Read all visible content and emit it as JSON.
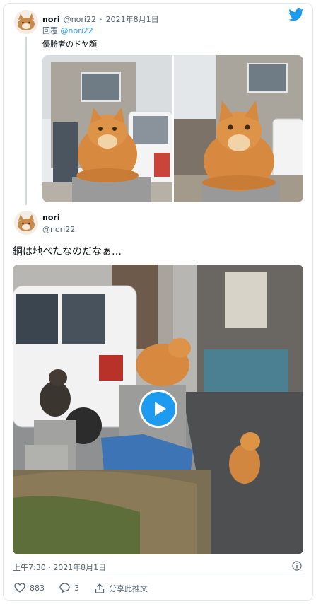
{
  "reply_tweet": {
    "name": "nori",
    "handle": "@nori22",
    "separator": "·",
    "date": "2021年8月1日",
    "reply_label": "回覆",
    "reply_to": "@nori22",
    "text": "優勝者のドヤ顔"
  },
  "main_tweet": {
    "name": "nori",
    "handle": "@nori22",
    "text": "銅は地べたなのだなぁ…",
    "timestamp": "上午7:30 · 2021年8月1日"
  },
  "actions": {
    "like_count": "883",
    "reply_count": "3",
    "share_label": "分享此推文"
  },
  "colors": {
    "accent": "#1d9bf0",
    "text_secondary": "#536471",
    "border": "#e1e8ed"
  },
  "icons": [
    "twitter-bird-icon",
    "info-icon",
    "heart-icon",
    "reply-icon",
    "share-icon",
    "play-icon"
  ]
}
